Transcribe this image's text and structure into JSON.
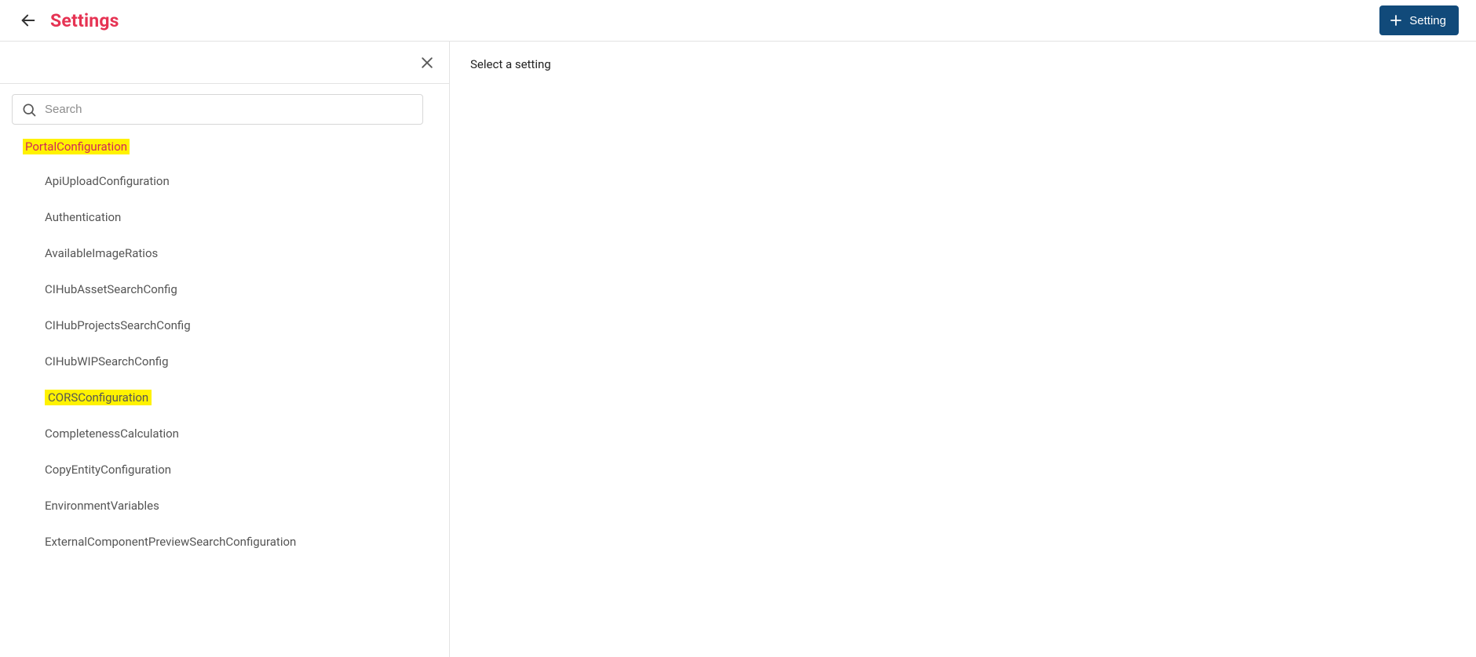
{
  "header": {
    "title": "Settings",
    "add_button_label": "Setting"
  },
  "sidebar": {
    "search_placeholder": "Search",
    "category": {
      "label": "PortalConfiguration",
      "highlighted": true
    },
    "items": [
      {
        "label": "ApiUploadConfiguration",
        "highlighted": false
      },
      {
        "label": "Authentication",
        "highlighted": false
      },
      {
        "label": "AvailableImageRatios",
        "highlighted": false
      },
      {
        "label": "CIHubAssetSearchConfig",
        "highlighted": false
      },
      {
        "label": "CIHubProjectsSearchConfig",
        "highlighted": false
      },
      {
        "label": "CIHubWIPSearchConfig",
        "highlighted": false
      },
      {
        "label": "CORSConfiguration",
        "highlighted": true
      },
      {
        "label": "CompletenessCalculation",
        "highlighted": false
      },
      {
        "label": "CopyEntityConfiguration",
        "highlighted": false
      },
      {
        "label": "EnvironmentVariables",
        "highlighted": false
      },
      {
        "label": "ExternalComponentPreviewSearchConfiguration",
        "highlighted": false
      }
    ]
  },
  "content": {
    "placeholder": "Select a setting"
  }
}
